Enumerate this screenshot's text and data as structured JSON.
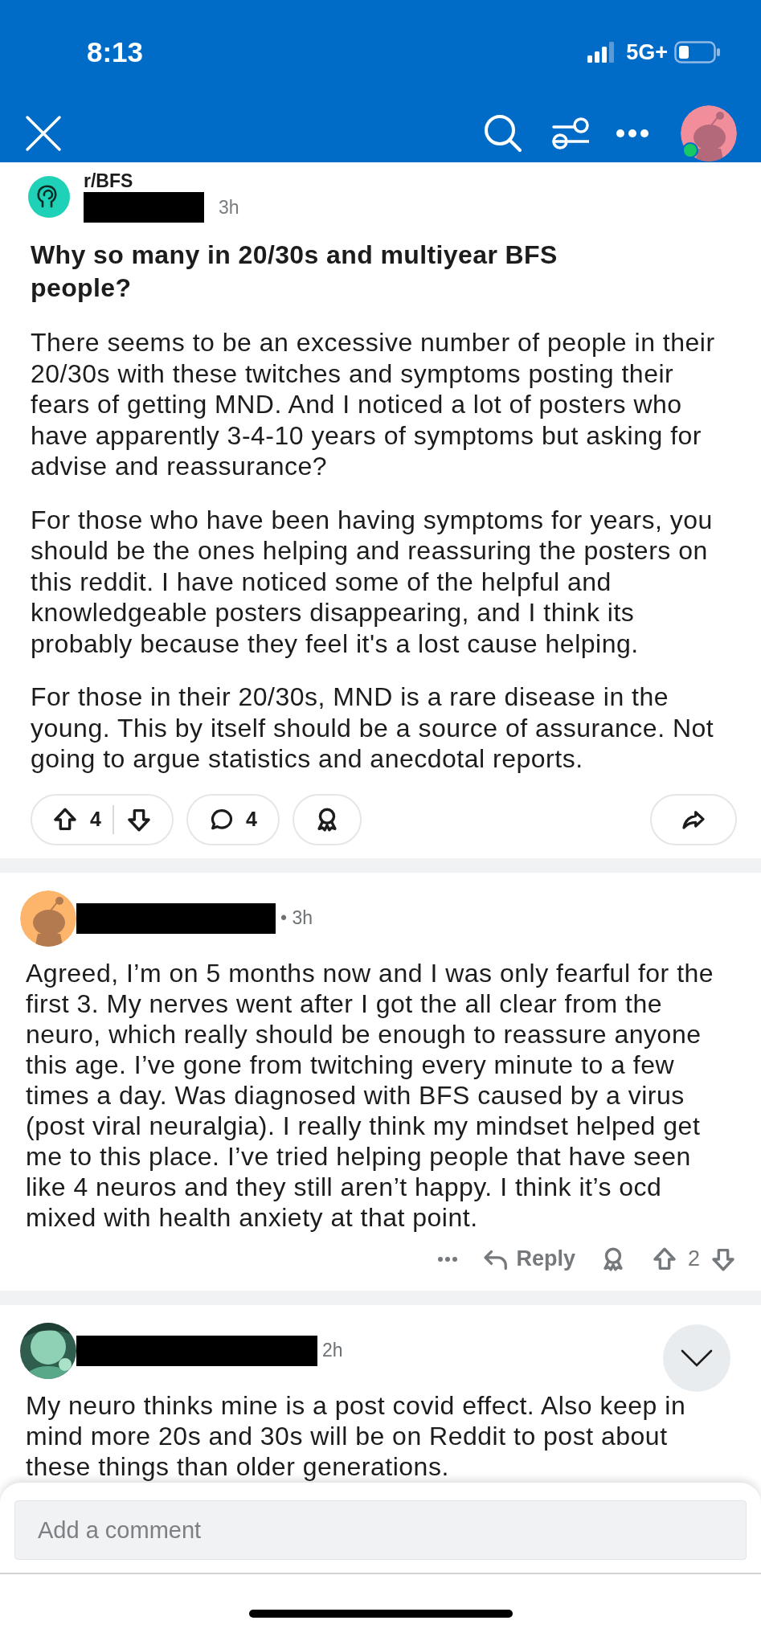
{
  "status_bar": {
    "time": "8:13",
    "network": "5G+"
  },
  "post": {
    "subreddit": "r/BFS",
    "age": "3h",
    "title": "Why so many in 20/30s and multiyear BFS people?",
    "paragraphs": [
      "There seems to be an excessive number of people in their 20/30s with these twitches and symptoms posting their fears of getting MND. And I noticed a lot of posters who have apparently 3-4-10 years of symptoms but asking for advise and reassurance?",
      "For those who have been having symptoms for years, you should be the ones helping and reassuring the posters on this reddit. I have noticed some of the helpful and knowledgeable posters disappearing, and I think its probably because they feel it's a lost cause helping.",
      "For those in their 20/30s, MND is a rare disease in the young. This by itself should be a source of assurance. Not going to argue statistics and anecdotal reports."
    ],
    "votes": "4",
    "comments": "4"
  },
  "comments": [
    {
      "kind": "snoo",
      "age": "• 3h",
      "body": "Agreed, I’m on 5 months now and I was only fearful for the first 3. My nerves went after I got the all clear from the neuro, which really should be enough to reassure anyone this age. I’ve gone from twitching every minute to a few times a day. Was diagnosed with BFS caused by a virus (post viral neuralgia). I really think my mindset helped get me to this place. I’ve tried helping people that have seen like 4 neuros and they still aren’t happy. I think it’s ocd mixed with health anxiety at that point.",
      "reply": "Reply",
      "votes": "2"
    },
    {
      "kind": "picture",
      "age": "2h",
      "body": "My neuro thinks mine is a post covid effect. Also keep in mind more 20s and 30s will be on Reddit to post about these things than older generations."
    }
  ],
  "composer": {
    "placeholder": "Add a comment"
  }
}
